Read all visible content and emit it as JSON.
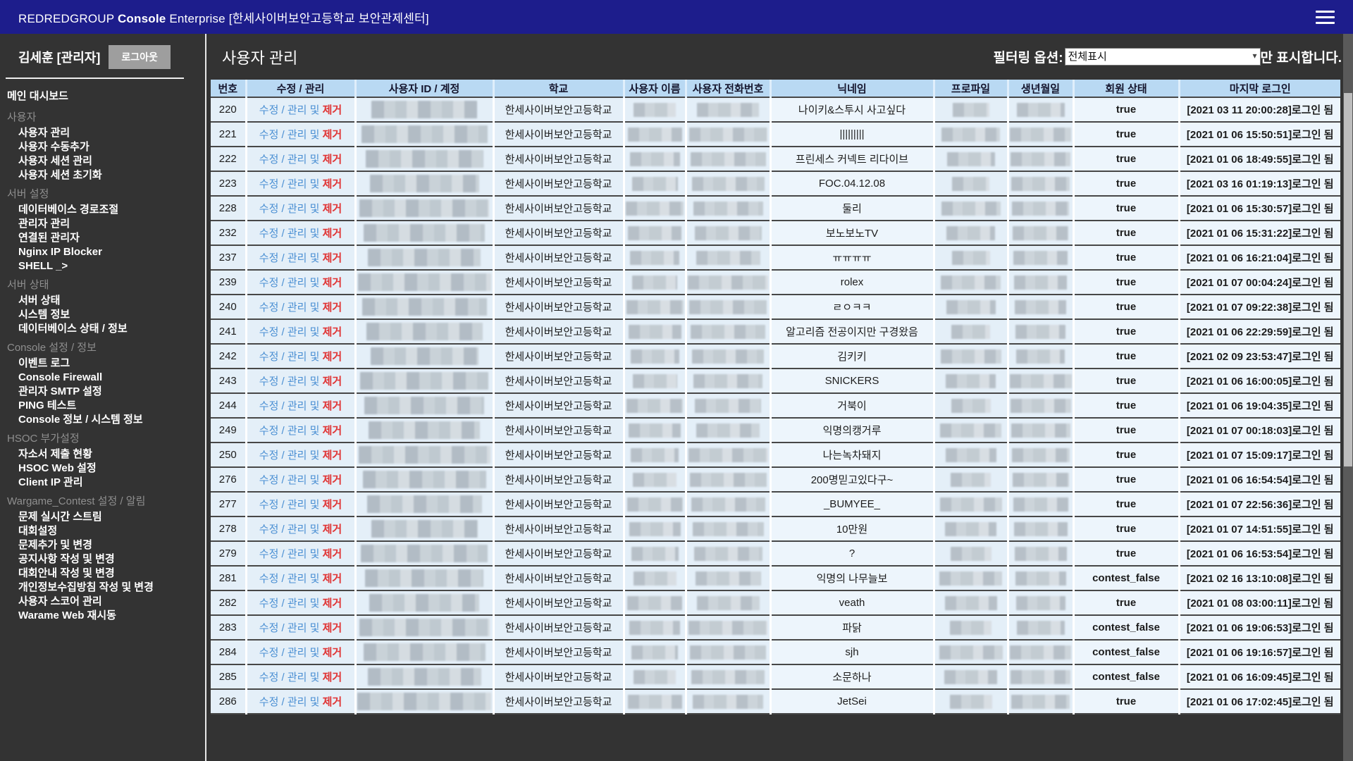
{
  "topbar": {
    "title_prefix": "REDREDGROUP ",
    "title_bold": "Console",
    "title_suffix": " Enterprise [한세사이버보안고등학교 보안관제센터]"
  },
  "sidebar": {
    "user_name": "김세훈 [관리자]",
    "logout_label": "로그아웃",
    "dashboard_label": "메인 대시보드",
    "sections": [
      {
        "label": "사용자",
        "items": [
          "사용자 관리",
          "사용자 수동추가",
          "사용자 세션 관리",
          "사용자 세션 초기화"
        ]
      },
      {
        "label": "서버 설정",
        "items": [
          "데이터베이스 경로조절",
          "관리자 관리",
          "연결된 관리자",
          "Nginx IP Blocker",
          "SHELL _>"
        ]
      },
      {
        "label": "서버 상태",
        "items": [
          "서버 상태",
          "시스템 정보",
          "데이터베이스 상태 / 정보"
        ]
      },
      {
        "label": "Console 설정 / 정보",
        "items": [
          "이벤트 로그",
          "Console Firewall",
          "관리자 SMTP 설정",
          "PING 테스트",
          "Console 정보 / 시스템 정보"
        ]
      },
      {
        "label": "HSOC 부가설정",
        "items": [
          "자소서 제출 현황",
          "HSOC Web 설정",
          "Client IP 관리"
        ]
      },
      {
        "label": "Wargame_Contest 설정 / 알림",
        "items": [
          "문제 실시간 스트림",
          "대회설정",
          "문제추가 및 변경",
          "공지사항 작성 및 변경",
          "대회안내 작성 및 변경",
          "개인정보수집방침 작성 및 변경",
          "사용자 스코어 관리",
          "Warame Web 재시동"
        ]
      }
    ]
  },
  "main": {
    "page_title": "사용자 관리",
    "filter_label": "필터링 옵션:",
    "filter_selected": "전체표시",
    "filter_suffix": "만 표시합니다."
  },
  "table": {
    "columns": [
      "번호",
      "수정 / 관리",
      "사용자 ID / 계정",
      "학교",
      "사용자 이름",
      "사용자 전화번호",
      "닉네임",
      "프로파일",
      "생년월일",
      "회원 상태",
      "마지막 로그인"
    ],
    "edit_link": "수정 / 관리 및",
    "remove_link": "제거",
    "school": "한세사이버보안고등학교",
    "rows": [
      {
        "no": "220",
        "nickname": "나이키&스투시 사고싶다",
        "status": "true",
        "last_login": "[2021 03 11 20:00:28]로그인 됨"
      },
      {
        "no": "221",
        "nickname": "|||||||||",
        "status": "true",
        "last_login": "[2021 01 06 15:50:51]로그인 됨"
      },
      {
        "no": "222",
        "nickname": "프린세스 커넥트 리다이브",
        "status": "true",
        "last_login": "[2021 01 06 18:49:55]로그인 됨"
      },
      {
        "no": "223",
        "nickname": "FOC.04.12.08",
        "status": "true",
        "last_login": "[2021 03 16 01:19:13]로그인 됨"
      },
      {
        "no": "228",
        "nickname": "둘리",
        "status": "true",
        "last_login": "[2021 01 06 15:30:57]로그인 됨"
      },
      {
        "no": "232",
        "nickname": "보노보노TV",
        "status": "true",
        "last_login": "[2021 01 06 15:31:22]로그인 됨"
      },
      {
        "no": "237",
        "nickname": "ㅠㅠㅠㅠ",
        "status": "true",
        "last_login": "[2021 01 06 16:21:04]로그인 됨"
      },
      {
        "no": "239",
        "nickname": "rolex",
        "status": "true",
        "last_login": "[2021 01 07 00:04:24]로그인 됨"
      },
      {
        "no": "240",
        "nickname": "ㄹㅇㅋㅋ",
        "status": "true",
        "last_login": "[2021 01 07 09:22:38]로그인 됨"
      },
      {
        "no": "241",
        "nickname": "알고리즘 전공이지만 구경왔음",
        "status": "true",
        "last_login": "[2021 01 06 22:29:59]로그인 됨"
      },
      {
        "no": "242",
        "nickname": "김키키",
        "status": "true",
        "last_login": "[2021 02 09 23:53:47]로그인 됨"
      },
      {
        "no": "243",
        "nickname": "SNICKERS",
        "status": "true",
        "last_login": "[2021 01 06 16:00:05]로그인 됨"
      },
      {
        "no": "244",
        "nickname": "거북이",
        "status": "true",
        "last_login": "[2021 01 06 19:04:35]로그인 됨"
      },
      {
        "no": "249",
        "nickname": "익명의캥거루",
        "status": "true",
        "last_login": "[2021 01 07 00:18:03]로그인 됨"
      },
      {
        "no": "250",
        "nickname": "나는녹차돼지",
        "status": "true",
        "last_login": "[2021 01 07 15:09:17]로그인 됨"
      },
      {
        "no": "276",
        "nickname": "200명믿고있다구~",
        "status": "true",
        "last_login": "[2021 01 06 16:54:54]로그인 됨"
      },
      {
        "no": "277",
        "nickname": "_BUMYEE_",
        "status": "true",
        "last_login": "[2021 01 07 22:56:36]로그인 됨"
      },
      {
        "no": "278",
        "nickname": "10만원",
        "status": "true",
        "last_login": "[2021 01 07 14:51:55]로그인 됨"
      },
      {
        "no": "279",
        "nickname": "?",
        "status": "true",
        "last_login": "[2021 01 06 16:53:54]로그인 됨"
      },
      {
        "no": "281",
        "nickname": "익명의 나무늘보",
        "status": "contest_false",
        "last_login": "[2021 02 16 13:10:08]로그인 됨"
      },
      {
        "no": "282",
        "nickname": "veath",
        "status": "true",
        "last_login": "[2021 01 08 03:00:11]로그인 됨"
      },
      {
        "no": "283",
        "nickname": "파닭",
        "status": "contest_false",
        "last_login": "[2021 01 06 19:06:53]로그인 됨"
      },
      {
        "no": "284",
        "nickname": "sjh",
        "status": "contest_false",
        "last_login": "[2021 01 06 19:16:57]로그인 됨"
      },
      {
        "no": "285",
        "nickname": "소문하나",
        "status": "contest_false",
        "last_login": "[2021 01 06 16:09:45]로그인 됨"
      },
      {
        "no": "286",
        "nickname": "JetSei",
        "status": "true",
        "last_login": "[2021 01 06 17:02:45]로그인 됨"
      }
    ]
  },
  "colors": {
    "topbar": "#1d1d8c",
    "background": "#333333",
    "table_header": "#b9d9f3",
    "row_tint": "#e4eff8",
    "row_light": "#edf5fc",
    "link_blue": "#4a8fd3",
    "link_red": "#e03434"
  }
}
